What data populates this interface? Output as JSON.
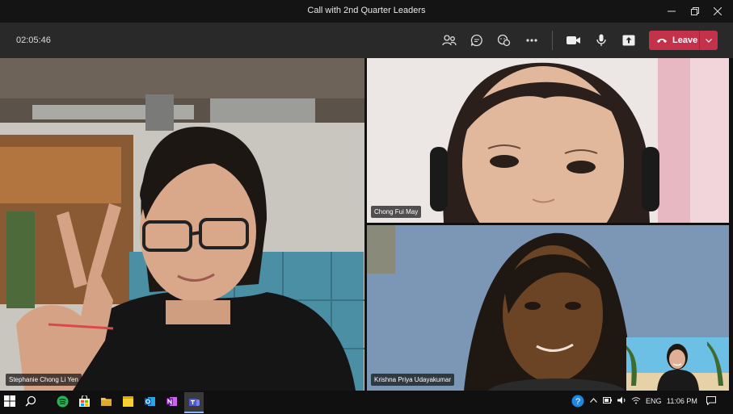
{
  "window": {
    "title": "Call with 2nd Quarter Leaders",
    "minimize_icon": "minimize-icon",
    "restore_icon": "restore-icon",
    "close_icon": "close-icon"
  },
  "toolbar": {
    "timer": "02:05:46",
    "icons": [
      "participants-icon",
      "chat-icon",
      "reactions-icon",
      "more-icon",
      "camera-icon",
      "microphone-icon",
      "share-icon"
    ],
    "leave_label": "Leave",
    "leave_color": "#c4314b"
  },
  "participants": [
    {
      "name": "Stephanie Chong Li Yen"
    },
    {
      "name": "Chong Fui May"
    },
    {
      "name": "Krishna Priya Udayakumar"
    }
  ],
  "taskbar": {
    "apps": [
      "windows-start-icon",
      "search-icon",
      "spotify-icon",
      "store-icon",
      "file-explorer-icon",
      "sticky-notes-icon",
      "outlook-icon",
      "onenote-icon",
      "teams-icon"
    ],
    "language": "ENG",
    "time": "11:06 PM"
  }
}
